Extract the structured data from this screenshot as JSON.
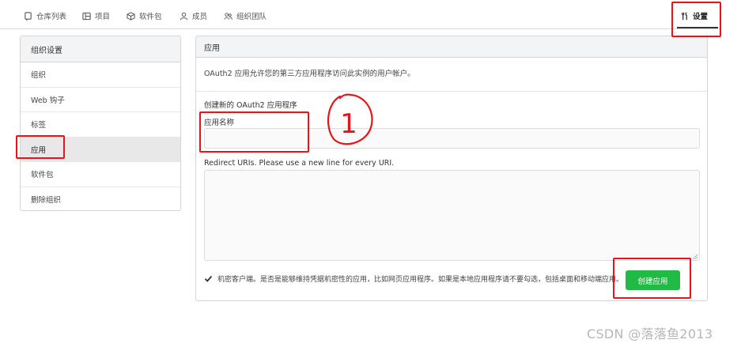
{
  "tabs": [
    {
      "label": "仓库列表",
      "icon": "repo-icon"
    },
    {
      "label": "项目",
      "icon": "project-board-icon"
    },
    {
      "label": "软件包",
      "icon": "package-icon"
    },
    {
      "label": "成员",
      "icon": "person-icon"
    },
    {
      "label": "组织团队",
      "icon": "people-icon"
    }
  ],
  "settings_tab": {
    "label": "设置",
    "icon": "tools-icon"
  },
  "sidebar": {
    "header": "组织设置",
    "items": [
      {
        "label": "组织"
      },
      {
        "label": "Web 钩子"
      },
      {
        "label": "标签"
      },
      {
        "label": "应用",
        "active": true
      },
      {
        "label": "软件包"
      },
      {
        "label": "删除组织"
      }
    ]
  },
  "panel": {
    "header": "应用",
    "description": "OAuth2 应用允许您的第三方应用程序访问此实例的用户帐户。",
    "section_title": "创建新的 OAuth2 应用程序",
    "name_label": "应用名称",
    "name_value": "",
    "uri_label": "Redirect URIs. Please use a new line for every URI.",
    "uri_value": "",
    "confidential_checked": true,
    "confidential_label": "机密客户端。是否是能够维持凭据机密性的应用，比如网页应用程序。如果是本地应用程序请不要勾选，包括桌面和移动端应用。",
    "create_button": "创建应用"
  },
  "annotation": {
    "circle_text": "1",
    "color": "#e8141b"
  },
  "watermark": "CSDN @落落鱼2013",
  "colors": {
    "accent_green": "#21ba45",
    "annotation_red": "#e8141b"
  }
}
